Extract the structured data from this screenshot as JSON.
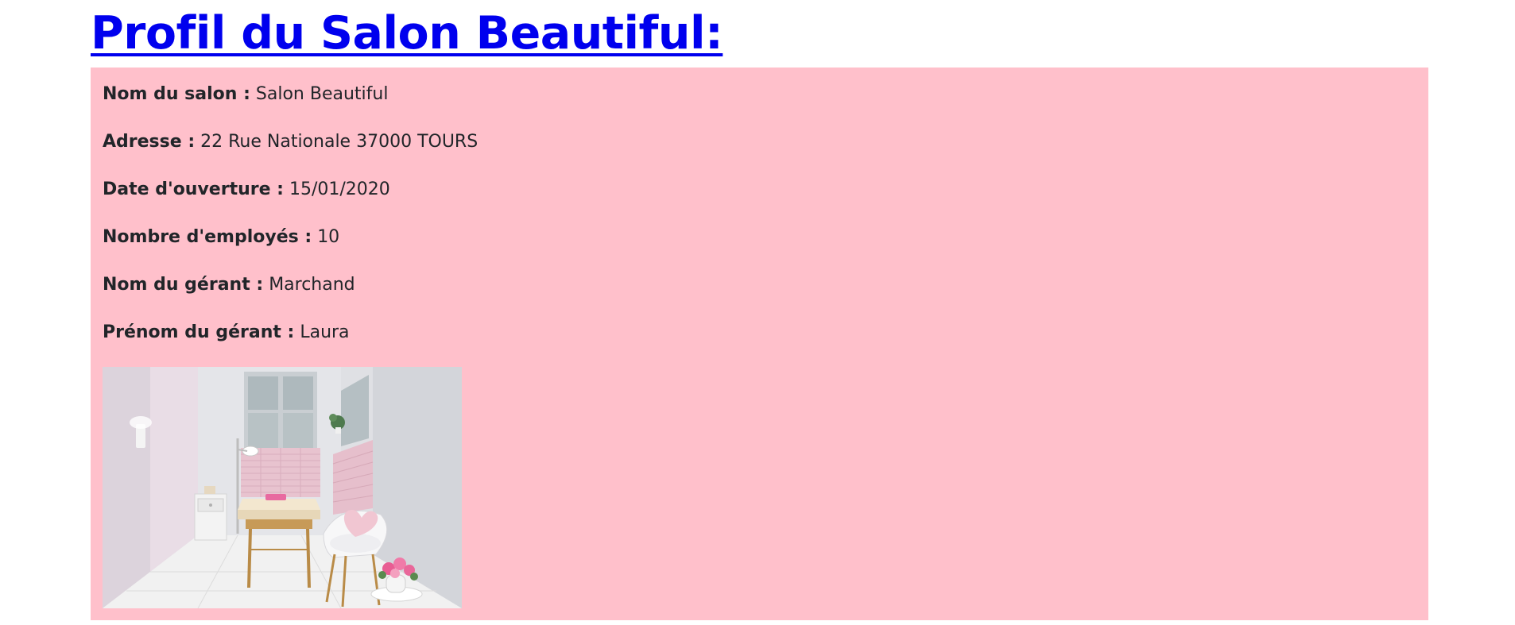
{
  "page": {
    "title": "Profil du Salon Beautiful:",
    "link_color": "#0000ee",
    "card_color": "#ffc0cb"
  },
  "profile": {
    "fields": [
      {
        "label": "Nom du salon :",
        "value": "Salon Beautiful"
      },
      {
        "label": "Adresse :",
        "value": "22 Rue Nationale 37000 TOURS"
      },
      {
        "label": "Date d'ouverture :",
        "value": "15/01/2020"
      },
      {
        "label": "Nombre d'employés :",
        "value": "10"
      },
      {
        "label": "Nom du gérant :",
        "value": "Marchand"
      },
      {
        "label": "Prénom du gérant :",
        "value": "Laura"
      }
    ]
  },
  "photo": {
    "subject": "salon-treatment-room"
  }
}
